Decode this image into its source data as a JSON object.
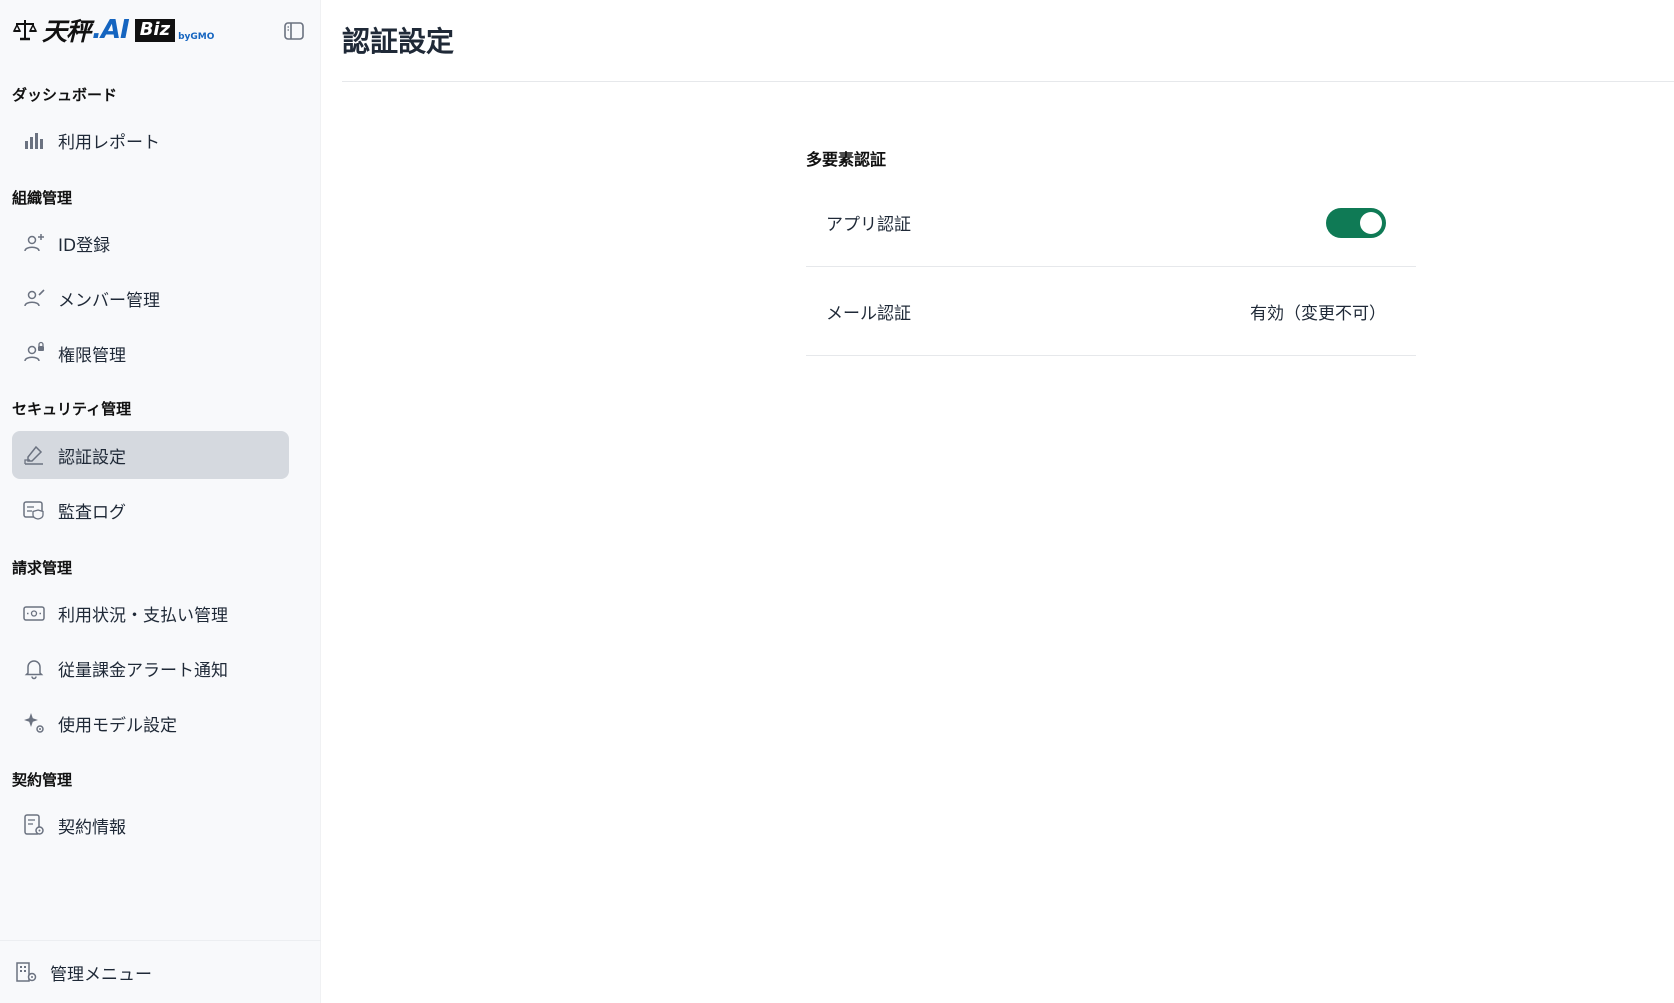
{
  "app": {
    "logo_main": "天秤",
    "logo_ai": ".AI",
    "logo_biz": "Biz",
    "logo_by": "byGMO"
  },
  "sidebar": {
    "sections": [
      {
        "title": "ダッシュボード",
        "items": [
          {
            "label": "利用レポート",
            "icon": "bar-chart-icon"
          }
        ]
      },
      {
        "title": "組織管理",
        "items": [
          {
            "label": "ID登録",
            "icon": "user-add-icon"
          },
          {
            "label": "メンバー管理",
            "icon": "user-edit-icon"
          },
          {
            "label": "権限管理",
            "icon": "user-lock-icon"
          }
        ]
      },
      {
        "title": "セキュリティ管理",
        "items": [
          {
            "label": "認証設定",
            "icon": "signature-icon",
            "active": true
          },
          {
            "label": "監査ログ",
            "icon": "audit-log-icon"
          }
        ]
      },
      {
        "title": "請求管理",
        "items": [
          {
            "label": "利用状況・支払い管理",
            "icon": "payment-icon"
          },
          {
            "label": "従量課金アラート通知",
            "icon": "bell-icon"
          },
          {
            "label": "使用モデル設定",
            "icon": "sparkle-gear-icon"
          }
        ]
      },
      {
        "title": "契約管理",
        "items": [
          {
            "label": "契約情報",
            "icon": "contract-gear-icon"
          }
        ]
      }
    ],
    "footer_label": "管理メニュー"
  },
  "main": {
    "title": "認証設定",
    "mfa": {
      "heading": "多要素認証",
      "rows": [
        {
          "label": "アプリ認証",
          "type": "toggle",
          "enabled": true
        },
        {
          "label": "メール認証",
          "type": "text",
          "value": "有効（変更不可）"
        }
      ]
    }
  },
  "colors": {
    "toggle_on": "#0f7a55",
    "active_nav": "#d5d9df",
    "sidebar_bg": "#f8f9fb",
    "logo_blue": "#1565c0"
  }
}
